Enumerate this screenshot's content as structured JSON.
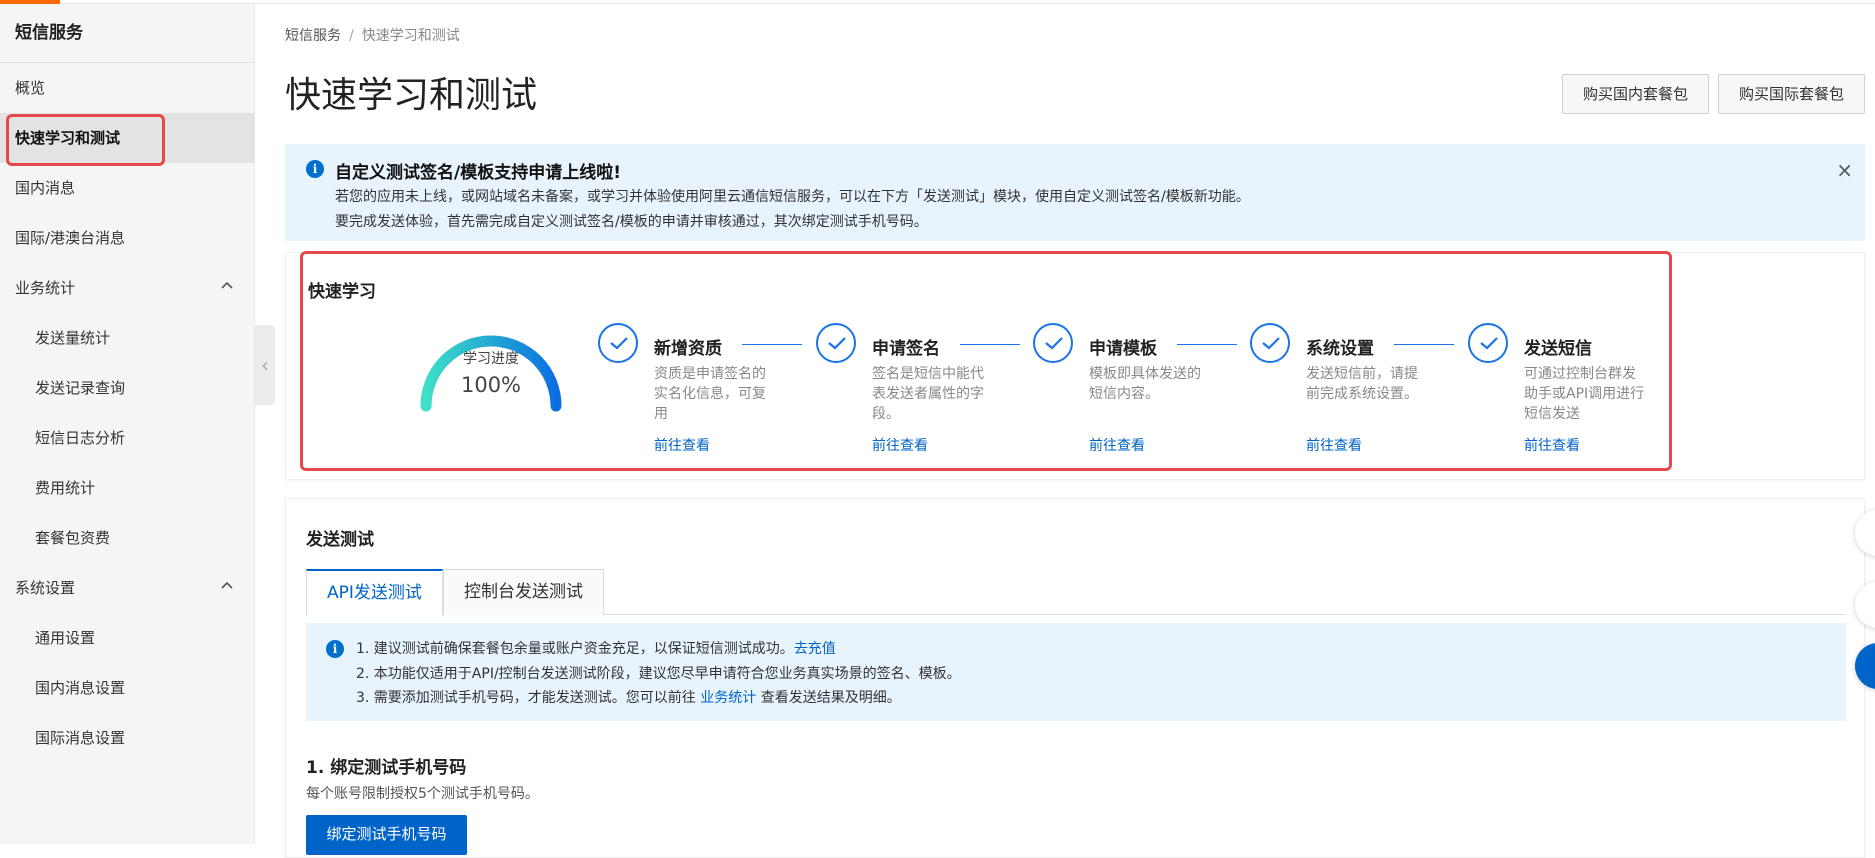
{
  "sidebar": {
    "title": "短信服务",
    "items": [
      {
        "label": "概览"
      },
      {
        "label": "快速学习和测试"
      },
      {
        "label": "国内消息"
      },
      {
        "label": "国际/港澳台消息"
      },
      {
        "label": "业务统计"
      },
      {
        "label": "发送量统计"
      },
      {
        "label": "发送记录查询"
      },
      {
        "label": "短信日志分析"
      },
      {
        "label": "费用统计"
      },
      {
        "label": "套餐包资费"
      },
      {
        "label": "系统设置"
      },
      {
        "label": "通用设置"
      },
      {
        "label": "国内消息设置"
      },
      {
        "label": "国际消息设置"
      }
    ],
    "active_item": "快速学习和测试"
  },
  "breadcrumb": {
    "root": "短信服务",
    "separator": "/",
    "current": "快速学习和测试"
  },
  "page": {
    "title": "快速学习和测试",
    "buy_domestic": "购买国内套餐包",
    "buy_international": "购买国际套餐包"
  },
  "notice": {
    "title": "自定义测试签名/模板支持申请上线啦!",
    "line1": "若您的应用未上线，或网站域名未备案，或学习并体验使用阿里云通信短信服务，可以在下方「发送测试」模块，使用自定义测试签名/模板新功能。",
    "line2": "要完成发送体验，首先需完成自定义测试签名/模板的申请并审核通过，其次绑定测试手机号码。",
    "close": "×"
  },
  "quick_learn": {
    "title": "快速学习",
    "progress_label": "学习进度",
    "progress_value": "100%",
    "progress_fraction": 1.0,
    "link_label": "前往查看",
    "steps": [
      {
        "title": "新增资质",
        "desc": "资质是申请签名的实名化信息，可复用"
      },
      {
        "title": "申请签名",
        "desc": "签名是短信中能代表发送者属性的字段。"
      },
      {
        "title": "申请模板",
        "desc": "模板即具体发送的短信内容。"
      },
      {
        "title": "系统设置",
        "desc": "发送短信前，请提前完成系统设置。"
      },
      {
        "title": "发送短信",
        "desc": "可通过控制台群发助手或API调用进行短信发送"
      }
    ]
  },
  "send_test": {
    "title": "发送测试",
    "tabs": [
      {
        "label": "API发送测试"
      },
      {
        "label": "控制台发送测试"
      }
    ],
    "tips": {
      "line1_text": "1. 建议测试前确保套餐包余量或账户资金充足，以保证短信测试成功。",
      "line1_link": "去充值",
      "line2": "2. 本功能仅适用于API/控制台发送测试阶段，建议您尽早申请符合您业务真实场景的签名、模板。",
      "line3_pre": "3. 需要添加测试手机号码，才能发送测试。您可以前往",
      "line3_link": "业务统计",
      "line3_post": "查看发送结果及明细。"
    },
    "bind_title": "1. 绑定测试手机号码",
    "bind_desc": "每个账号限制授权5个测试手机号码。",
    "bind_button": "绑定测试手机号码"
  },
  "colors": {
    "accent": "#0064c8",
    "highlight": "#e5484d",
    "info_bg": "#e7f3fd",
    "brand_orange": "#ff6a00"
  }
}
